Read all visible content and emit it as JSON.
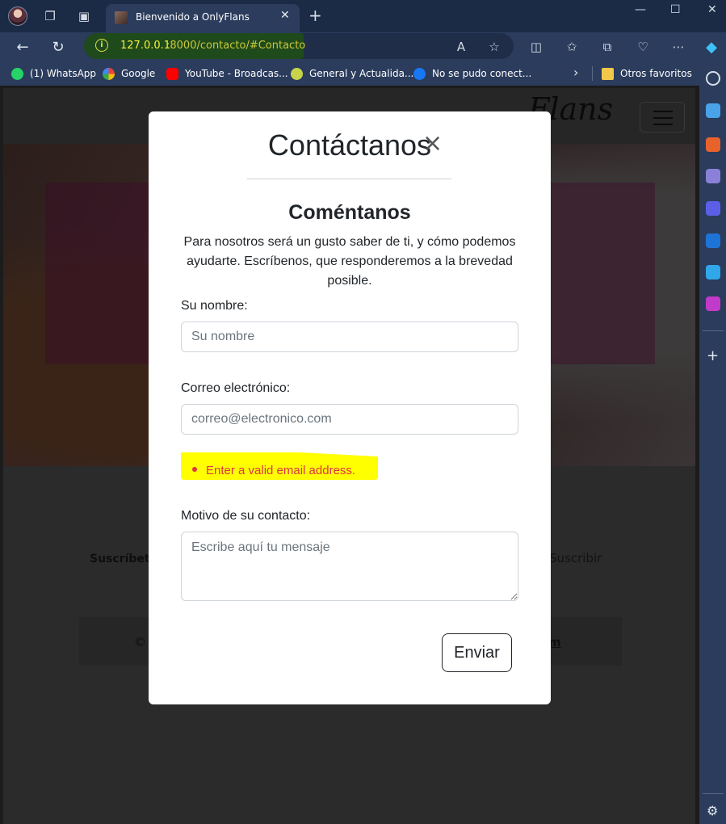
{
  "browser": {
    "tab_title": "Bienvenido a OnlyFlans",
    "tab_close": "✕",
    "new_tab": "+",
    "url_host": "127.0.0.1",
    "url_path": ":8000/contacto/#Contacto",
    "bookmarks": [
      {
        "label": "(1) WhatsApp",
        "icon": "whatsapp-icon",
        "color": "#25d366"
      },
      {
        "label": "Google",
        "icon": "google-icon",
        "color": "#4285f4"
      },
      {
        "label": "YouTube - Broadcas...",
        "icon": "youtube-icon",
        "color": "#ff0000"
      },
      {
        "label": "General y Actualida...",
        "icon": "pixel-icon",
        "color": "#c7d44a"
      },
      {
        "label": "No se pudo conect...",
        "icon": "facebook-icon",
        "color": "#1877f2"
      },
      {
        "label": "Otros favoritos",
        "icon": "folder-icon",
        "color": "#f2c84b"
      }
    ]
  },
  "page": {
    "brand": "Flans",
    "subscribe_text": "Suscríbete",
    "subscribe_button": "Suscribir",
    "footer_copy": "©",
    "footer_link": "m"
  },
  "modal": {
    "title": "Contáctanos",
    "close": "×",
    "section_title": "Coméntanos",
    "description": "Para nosotros será un gusto saber de ti, y cómo podemos ayudarte. Escríbenos, que responderemos a la brevedad posible.",
    "name_label": "Su nombre:",
    "name_placeholder": "Su nombre",
    "email_label": "Correo electrónico:",
    "email_placeholder": "correo@electronico.com",
    "email_error": "Enter a valid email address.",
    "message_label": "Motivo de su contacto:",
    "message_placeholder": "Escribe aquí tu mensaje",
    "submit": "Enviar"
  },
  "colors": {
    "error": "#dc3545",
    "highlight": "#ffff00",
    "browser_frame": "#2b3c5d"
  }
}
